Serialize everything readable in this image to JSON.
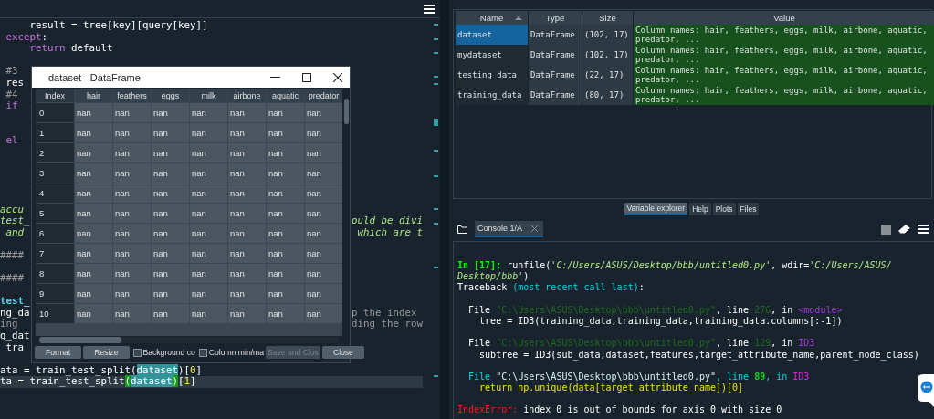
{
  "editor": {
    "lines": [
      {
        "kind": "code",
        "current": false,
        "parts": [
          {
            "text": "     result = tree[key][query[key]]",
            "kind": "plain"
          }
        ]
      },
      {
        "kind": "code",
        "current": false,
        "parts": [
          {
            "text": " except",
            "kind": "keyword"
          },
          {
            "text": ":",
            "kind": "plain"
          }
        ]
      },
      {
        "kind": "code",
        "current": false,
        "parts": [
          {
            "text": "     return",
            "kind": "keyword"
          },
          {
            "text": " default",
            "kind": "plain"
          }
        ]
      },
      {
        "kind": "blank"
      },
      {
        "kind": "code",
        "current": false,
        "parts": [
          {
            "text": " #3",
            "kind": "comment"
          }
        ]
      },
      {
        "kind": "code",
        "current": false,
        "parts": [
          {
            "text": " res",
            "kind": "plain"
          }
        ]
      },
      {
        "kind": "code",
        "current": false,
        "parts": [
          {
            "text": " #4",
            "kind": "comment"
          }
        ]
      },
      {
        "kind": "code",
        "current": false,
        "parts": [
          {
            "text": " if",
            "kind": "keyword"
          }
        ]
      },
      {
        "kind": "blank"
      },
      {
        "kind": "blank"
      },
      {
        "kind": "code",
        "current": false,
        "parts": [
          {
            "text": " el",
            "kind": "keyword"
          }
        ]
      },
      {
        "kind": "blank"
      },
      {
        "kind": "blank"
      },
      {
        "kind": "blank"
      },
      {
        "kind": "blank"
      },
      {
        "kind": "blank"
      },
      {
        "kind": "code",
        "current": false,
        "parts": [
          {
            "text": "accu",
            "kind": "docstring"
          }
        ]
      },
      {
        "kind": "code",
        "current": false,
        "parts": [
          {
            "text": "test_",
            "kind": "docstring"
          }
        ],
        "right_parts": [
          {
            "text": "ould be divi",
            "kind": "docstring"
          }
        ]
      },
      {
        "kind": "code",
        "current": false,
        "parts": [
          {
            "text": " and",
            "kind": "docstring"
          }
        ],
        "right_parts": [
          {
            "text": " which are t",
            "kind": "docstring"
          }
        ]
      },
      {
        "kind": "blank"
      },
      {
        "kind": "code",
        "current": false,
        "parts": [
          {
            "text": "####",
            "kind": "comment"
          }
        ]
      },
      {
        "kind": "blank"
      },
      {
        "kind": "code",
        "current": false,
        "parts": [
          {
            "text": "####",
            "kind": "comment"
          }
        ]
      },
      {
        "kind": "blank"
      },
      {
        "kind": "code",
        "current": false,
        "parts": [
          {
            "text": "test_",
            "kind": "definition"
          }
        ]
      },
      {
        "kind": "code",
        "current": false,
        "parts": [
          {
            "text": "ng_da",
            "kind": "plain"
          }
        ],
        "right_parts": [
          {
            "text": "p the index",
            "kind": "comment"
          }
        ]
      },
      {
        "kind": "code",
        "current": false,
        "parts": [
          {
            "text": "ing",
            "kind": "comment"
          }
        ],
        "right_parts": [
          {
            "text": "ding the row",
            "kind": "comment"
          }
        ]
      },
      {
        "kind": "code",
        "current": false,
        "parts": [
          {
            "text": "g_dat",
            "kind": "plain"
          }
        ]
      },
      {
        "kind": "code",
        "current": false,
        "parts": [
          {
            "text": " tra",
            "kind": "plain"
          }
        ]
      },
      {
        "kind": "blank"
      },
      {
        "kind": "code",
        "current": false,
        "parts": [
          {
            "text": "ata = train_test_split(",
            "kind": "plain"
          },
          {
            "text": "dataset",
            "kind": "occurrence"
          },
          {
            "text": ")[",
            "kind": "plain"
          },
          {
            "text": "0",
            "kind": "number"
          },
          {
            "text": "]",
            "kind": "plain"
          }
        ]
      },
      {
        "kind": "code",
        "current": true,
        "parts": [
          {
            "text": "ta = train_test_split",
            "kind": "plain"
          },
          {
            "text": "(",
            "kind": "bracket"
          },
          {
            "text": "dataset",
            "kind": "occurrence"
          },
          {
            "text": ")",
            "kind": "bracket"
          },
          {
            "text": "[",
            "kind": "plain"
          },
          {
            "text": "1",
            "kind": "number"
          },
          {
            "text": "]",
            "kind": "plain"
          }
        ]
      }
    ]
  },
  "dataframe_window": {
    "title": "dataset - DataFrame",
    "columns": [
      "Index",
      "hair",
      "feathers",
      "eggs",
      "milk",
      "airbone",
      "aquatic",
      "predator"
    ],
    "rows": [
      {
        "cells": [
          "0",
          "nan",
          "nan",
          "nan",
          "nan",
          "nan",
          "nan",
          "nan"
        ]
      },
      {
        "cells": [
          "1",
          "nan",
          "nan",
          "nan",
          "nan",
          "nan",
          "nan",
          "nan"
        ]
      },
      {
        "cells": [
          "2",
          "nan",
          "nan",
          "nan",
          "nan",
          "nan",
          "nan",
          "nan"
        ]
      },
      {
        "cells": [
          "3",
          "nan",
          "nan",
          "nan",
          "nan",
          "nan",
          "nan",
          "nan"
        ]
      },
      {
        "cells": [
          "4",
          "nan",
          "nan",
          "nan",
          "nan",
          "nan",
          "nan",
          "nan"
        ]
      },
      {
        "cells": [
          "5",
          "nan",
          "nan",
          "nan",
          "nan",
          "nan",
          "nan",
          "nan"
        ]
      },
      {
        "cells": [
          "6",
          "nan",
          "nan",
          "nan",
          "nan",
          "nan",
          "nan",
          "nan"
        ]
      },
      {
        "cells": [
          "7",
          "nan",
          "nan",
          "nan",
          "nan",
          "nan",
          "nan",
          "nan"
        ]
      },
      {
        "cells": [
          "8",
          "nan",
          "nan",
          "nan",
          "nan",
          "nan",
          "nan",
          "nan"
        ]
      },
      {
        "cells": [
          "9",
          "nan",
          "nan",
          "nan",
          "nan",
          "nan",
          "nan",
          "nan"
        ]
      },
      {
        "cells": [
          "10",
          "nan",
          "nan",
          "nan",
          "nan",
          "nan",
          "nan",
          "nan"
        ]
      }
    ],
    "controls": [
      {
        "kind": "button",
        "label": "Format",
        "disabled": false
      },
      {
        "kind": "button",
        "label": "Resize",
        "disabled": false
      },
      {
        "kind": "checkbox",
        "label": "Background co",
        "checked": false
      },
      {
        "kind": "checkbox",
        "label": "Column min/ma",
        "checked": false
      },
      {
        "kind": "button",
        "label": "Save and Clos",
        "disabled": true
      },
      {
        "kind": "button",
        "label": "Close",
        "disabled": false
      }
    ]
  },
  "variable_explorer": {
    "columns": [
      {
        "label": "Name",
        "sorted": true
      },
      {
        "label": "Type",
        "sorted": false
      },
      {
        "label": "Size",
        "sorted": false
      },
      {
        "label": "Value",
        "sorted": false
      }
    ],
    "rows": [
      {
        "name": "dataset",
        "type": "DataFrame",
        "size": "(102, 17)",
        "value": "Column names: hair, feathers, eggs, milk, airbone, aquatic, predator, ...",
        "selected": true
      },
      {
        "name": "mydataset",
        "type": "DataFrame",
        "size": "(102, 17)",
        "value": "Column names: hair, feathers, eggs, milk, airbone, aquatic, predator, ...",
        "selected": false
      },
      {
        "name": "testing_data",
        "type": "DataFrame",
        "size": "(22, 17)",
        "value": "Column names: hair, feathers, eggs, milk, airbone, aquatic, predator, ...",
        "selected": false
      },
      {
        "name": "training_data",
        "type": "DataFrame",
        "size": "(80, 17)",
        "value": "Column names: hair, feathers, eggs, milk, airbone, aquatic, predator, ...",
        "selected": false
      }
    ]
  },
  "pane_tabs": [
    {
      "label": "Variable explorer",
      "selected": true
    },
    {
      "label": "Help",
      "selected": false
    },
    {
      "label": "Plots",
      "selected": false
    },
    {
      "label": "Files",
      "selected": false
    }
  ],
  "console": {
    "tab": "Console 1/A",
    "lines": [
      {
        "kind": "text",
        "parts": [
          {
            "text": "In [17]: ",
            "kind": "prompt"
          },
          {
            "text": "runfile(",
            "kind": "plain"
          },
          {
            "text": "'C:/Users/ASUS/Desktop/bbb/untitled0.py'",
            "kind": "string"
          },
          {
            "text": ", wdir=",
            "kind": "plain"
          },
          {
            "text": "'C:/Users/ASUS/",
            "kind": "string"
          }
        ]
      },
      {
        "kind": "text",
        "parts": [
          {
            "text": "Desktop/bbb'",
            "kind": "string"
          },
          {
            "text": ")",
            "kind": "plain"
          }
        ]
      },
      {
        "kind": "text",
        "parts": [
          {
            "text": "Traceback ",
            "kind": "plain"
          },
          {
            "text": "(most recent call last)",
            "kind": "cyan"
          },
          {
            "text": ":",
            "kind": "plain"
          }
        ]
      },
      {
        "kind": "blank"
      },
      {
        "kind": "text",
        "parts": [
          {
            "text": "  File ",
            "kind": "plain"
          },
          {
            "text": "\"C:\\Users\\ASUS\\Desktop\\bbb\\untitled0.py\"",
            "kind": "dim"
          },
          {
            "text": ", line ",
            "kind": "plain"
          },
          {
            "text": "276",
            "kind": "dim"
          },
          {
            "text": ", in ",
            "kind": "plain"
          },
          {
            "text": "<module>",
            "kind": "purple"
          }
        ]
      },
      {
        "kind": "text",
        "parts": [
          {
            "text": "    tree = ID3(training_data,training_data,training_data.columns[:-1])",
            "kind": "plain"
          }
        ]
      },
      {
        "kind": "blank"
      },
      {
        "kind": "text",
        "parts": [
          {
            "text": "  File ",
            "kind": "plain"
          },
          {
            "text": "\"C:\\Users\\ASUS\\Desktop\\bbb\\untitled0.py\"",
            "kind": "dim"
          },
          {
            "text": ", line ",
            "kind": "plain"
          },
          {
            "text": "129",
            "kind": "dim"
          },
          {
            "text": ", in ",
            "kind": "plain"
          },
          {
            "text": "ID3",
            "kind": "purple"
          }
        ]
      },
      {
        "kind": "text",
        "parts": [
          {
            "text": "    subtree = ID3(sub_data,dataset,features,target_attribute_name,parent_node_class)",
            "kind": "plain"
          }
        ]
      },
      {
        "kind": "blank"
      },
      {
        "kind": "text",
        "parts": [
          {
            "text": "  File ",
            "kind": "cyan"
          },
          {
            "text": "\"C:\\Users\\ASUS\\Desktop\\bbb\\untitled0.py\"",
            "kind": "pale"
          },
          {
            "text": ", line ",
            "kind": "cyan"
          },
          {
            "text": "89",
            "kind": "green"
          },
          {
            "text": ", in ",
            "kind": "cyan"
          },
          {
            "text": "ID3",
            "kind": "magenta"
          }
        ]
      },
      {
        "kind": "text",
        "parts": [
          {
            "text": "    return np.unique(data[target_attribute_name])[0]",
            "kind": "yellow"
          }
        ]
      },
      {
        "kind": "blank"
      },
      {
        "kind": "text",
        "parts": [
          {
            "text": "IndexError: ",
            "kind": "red"
          },
          {
            "text": "index 0 is out of bounds for axis 0 with size 0",
            "kind": "plain"
          }
        ]
      }
    ]
  }
}
